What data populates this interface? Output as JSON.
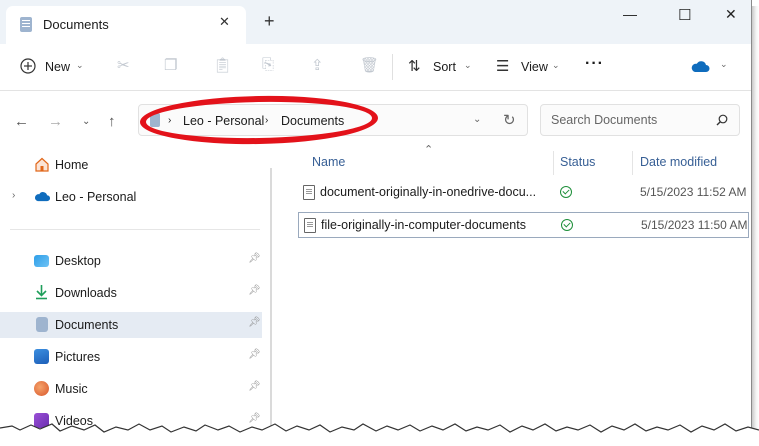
{
  "titlebar": {
    "tab_title": "Documents",
    "tab_close": "✕",
    "new_tab": "+",
    "minimize": "—",
    "maximize": "☐",
    "close": "✕"
  },
  "toolbar": {
    "new_label": "New",
    "sort_label": "Sort",
    "view_label": "View",
    "more_label": "···"
  },
  "address": {
    "crumbs": [
      "Leo - Personal",
      "Documents"
    ],
    "search_placeholder": "Search Documents"
  },
  "sidebar": {
    "items": [
      {
        "label": "Home",
        "icon": "home-icon"
      },
      {
        "label": "Leo - Personal",
        "icon": "onedrive-icon"
      },
      {
        "label": "Desktop",
        "icon": "desktop-icon"
      },
      {
        "label": "Downloads",
        "icon": "download-icon"
      },
      {
        "label": "Documents",
        "icon": "documents-icon"
      },
      {
        "label": "Pictures",
        "icon": "pictures-icon"
      },
      {
        "label": "Music",
        "icon": "music-icon"
      },
      {
        "label": "Videos",
        "icon": "videos-icon"
      }
    ]
  },
  "columns": {
    "name": "Name",
    "status": "Status",
    "date": "Date modified"
  },
  "files": [
    {
      "name": "document-originally-in-onedrive-docu...",
      "date": "5/15/2023 11:52 AM"
    },
    {
      "name": "file-originally-in-computer-documents",
      "date": "5/15/2023 11:50 AM"
    }
  ],
  "colors": {
    "accent": "#0067c0",
    "highlight_ellipse": "#e3121a",
    "status_ok": "#1e8f3a"
  }
}
